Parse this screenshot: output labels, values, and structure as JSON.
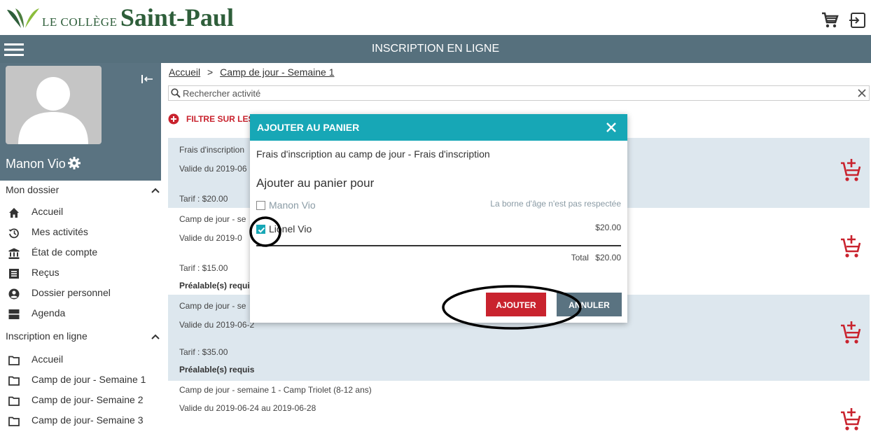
{
  "header": {
    "logo_small": "LE COLLÈGE",
    "logo_big": "Saint-Paul",
    "icons": [
      "cart-icon",
      "logout-icon"
    ]
  },
  "navbar": {
    "title": "INSCRIPTION EN LIGNE"
  },
  "sidebar": {
    "user_name": "Manon Vio",
    "sections": [
      {
        "title": "Mon dossier",
        "items": [
          {
            "label": "Accueil",
            "icon": "home-icon"
          },
          {
            "label": "Mes activités",
            "icon": "history-icon"
          },
          {
            "label": "État de compte",
            "icon": "bank-icon"
          },
          {
            "label": "Reçus",
            "icon": "receipt-icon"
          },
          {
            "label": "Dossier personnel",
            "icon": "account-icon"
          },
          {
            "label": "Agenda",
            "icon": "calendar-icon"
          }
        ]
      },
      {
        "title": "Inscription en ligne",
        "items": [
          {
            "label": "Accueil",
            "icon": "folder-icon"
          },
          {
            "label": "Camp de jour - Semaine 1",
            "icon": "folder-icon"
          },
          {
            "label": "Camp de jour- Semaine 2",
            "icon": "folder-icon"
          },
          {
            "label": "Camp de jour- Semaine 3",
            "icon": "folder-icon"
          }
        ]
      }
    ]
  },
  "breadcrumb": {
    "home": "Accueil",
    "separator": ">",
    "current": "Camp de jour - Semaine 1"
  },
  "search": {
    "placeholder": "Rechercher activité",
    "value": ""
  },
  "filter": {
    "label": "FILTRE SUR LES"
  },
  "activities": [
    {
      "title": "Frais d'inscription",
      "valid": "Valide du 2019-06",
      "price": "Tarif : $20.00",
      "prereq": ""
    },
    {
      "title": "Camp de jour - se",
      "valid": "Valide du 2019-0",
      "price": "Tarif : $15.00",
      "prereq": "Préalable(s) requi"
    },
    {
      "title": "Camp de jour - se",
      "valid": "Valide du 2019-06-2",
      "price": "Tarif : $35.00",
      "prereq": "Préalable(s) requis"
    },
    {
      "title": "Camp de jour - semaine 1 - Camp Triolet (8-12 ans)",
      "valid": "Valide du 2019-06-24 au 2019-06-28",
      "price": "",
      "prereq": ""
    }
  ],
  "modal": {
    "title": "AJOUTER AU PANIER",
    "subtitle": "Frais d'inscription au camp de jour - Frais d'inscription",
    "heading": "Ajouter au panier pour",
    "options": [
      {
        "name": "Manon Vio",
        "checked": false,
        "note": "La borne d'âge n'est pas respectée",
        "price": ""
      },
      {
        "name": "Lionel Vio",
        "checked": true,
        "note": "",
        "price": "$20.00"
      }
    ],
    "total_label": "Total",
    "total_value": "$20.00",
    "ok_label": "AJOUTER",
    "cancel_label": "ANNULER"
  },
  "colors": {
    "navbar": "#56707d",
    "accent": "#17a7b6",
    "primary_button": "#c9232e",
    "cart": "#c9232e",
    "row_highlight": "#dde7ee"
  }
}
